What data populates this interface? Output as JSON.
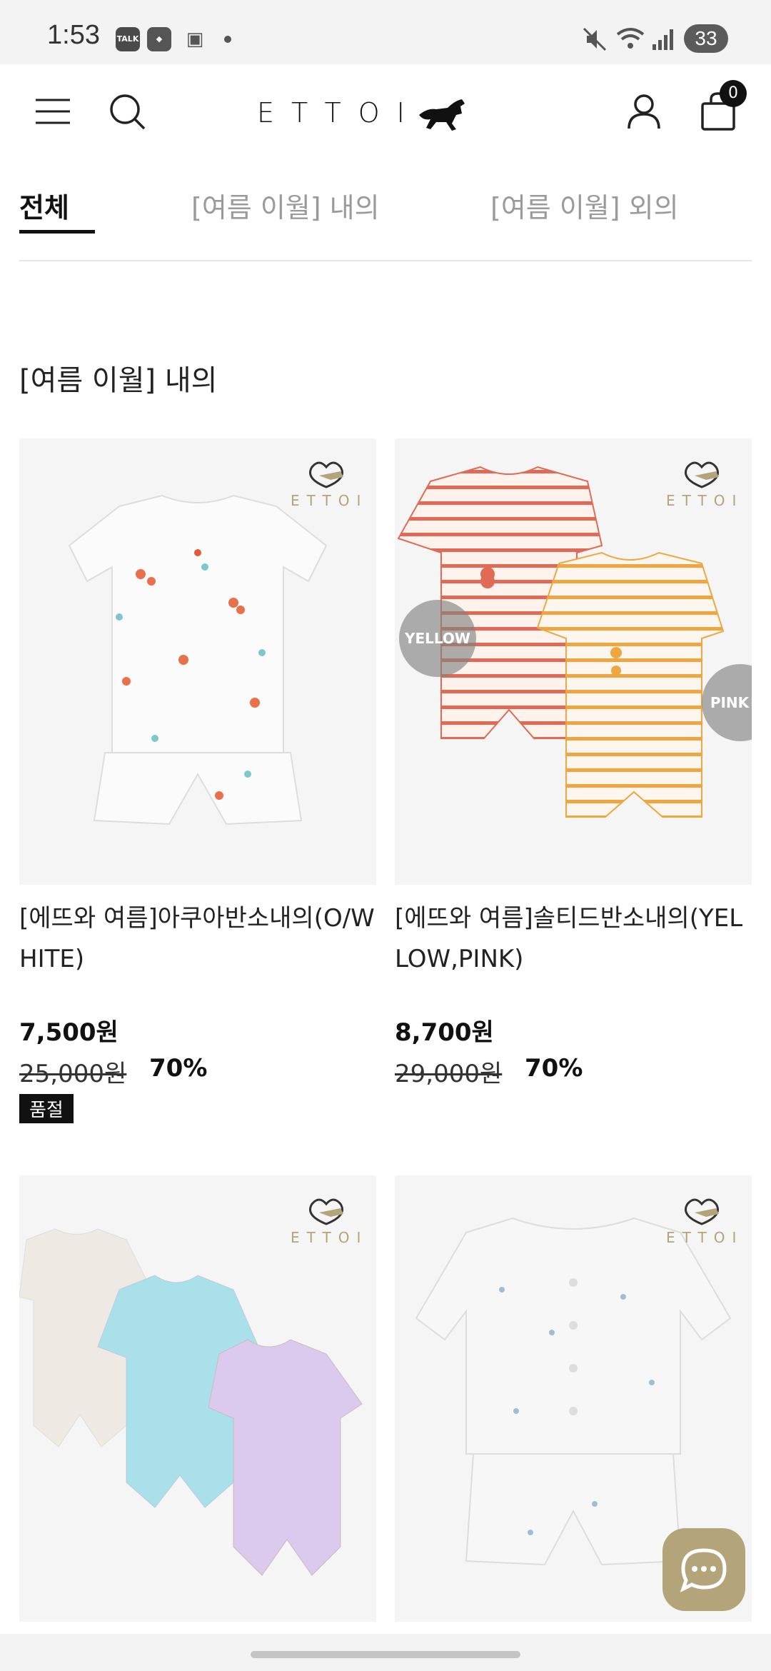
{
  "status_bar": {
    "time": "1:53",
    "app_icons": [
      "TALK",
      "cube-icon",
      "screenshot-icon"
    ],
    "battery": "33"
  },
  "header": {
    "logo_text": "ETTOI",
    "cart_count": "0"
  },
  "tabs": [
    {
      "label": "전체",
      "active": true
    },
    {
      "label": "[여름 이월] 내의",
      "active": false
    },
    {
      "label": "[여름 이월] 외의",
      "active": false
    }
  ],
  "section_title": "[여름 이월] 내의",
  "brand_mark_text": "ETTOI",
  "products": [
    {
      "name": "[에뜨와 여름]아쿠아반소내의(O/WHITE)",
      "price": "7,500원",
      "original_price": "25,000원",
      "discount": "70%",
      "badge": "품절",
      "image_desc": "white aqua print short sleeve set"
    },
    {
      "name": "[에뜨와 여름]솔티드반소내의(YELLOW,PINK)",
      "price": "8,700원",
      "original_price": "29,000원",
      "discount": "70%",
      "badge": "",
      "color_chips": [
        "YELLOW",
        "PINK"
      ],
      "image_desc": "striped short sleeve rompers"
    },
    {
      "name": "",
      "image_desc": "pastel rompers beige blue lilac"
    },
    {
      "name": "",
      "image_desc": "white patterned set"
    }
  ],
  "colors": {
    "accent_chat": "#b3a47a",
    "active_tab": "#111111",
    "inactive_tab": "#9a9a9a",
    "stripe_red": "#e06a55",
    "stripe_orange": "#f0a640"
  }
}
